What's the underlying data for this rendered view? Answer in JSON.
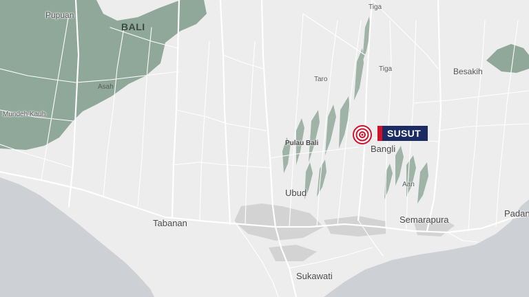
{
  "map": {
    "region_label": "BALI",
    "places": {
      "pupuan": "Pupuan",
      "asah": "Asah",
      "mundeh_kauh": "Mundeh Kauh",
      "tiga_north": "Tiga",
      "tiga": "Tiga",
      "taro": "Taro",
      "besakih": "Besakih",
      "pulau_bali": "Pulau Bali",
      "bangli": "Bangli",
      "aan": "Aan",
      "ubud": "Ubud",
      "tabanan": "Tabanan",
      "semarapura": "Semarapura",
      "padang": "Padan",
      "sukawati": "Sukawati"
    },
    "volcano_label": "SUSUT",
    "colors": {
      "land": "#ededed",
      "sea": "#cdd1d6",
      "forest": "#8fa89a",
      "roads": "#ffffff",
      "label_box": "#1d2b64",
      "accent": "#d2102a"
    },
    "marker_icon": "earthquake-epicenter-icon"
  }
}
